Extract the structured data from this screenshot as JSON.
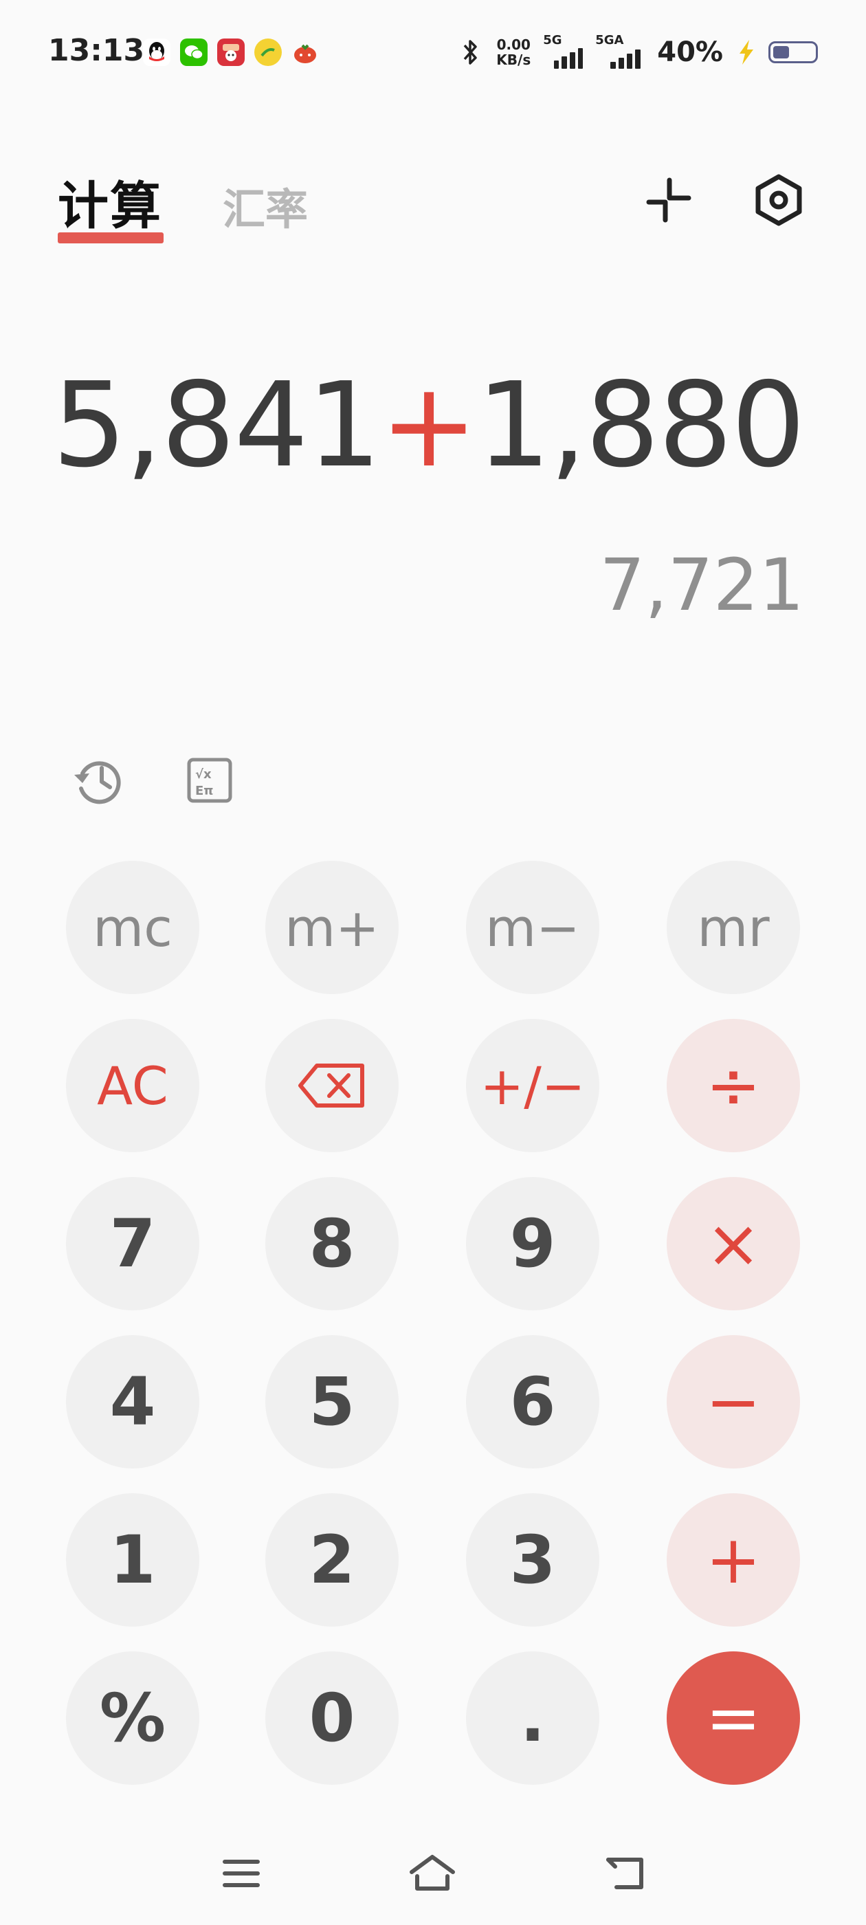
{
  "status_bar": {
    "time": "13:13",
    "net_speed_value": "0.00",
    "net_speed_unit": "KB/s",
    "signal1_label": "5G",
    "signal2_label": "5GA",
    "battery_percent": "40%",
    "battery_level": 0.4,
    "app_icons": [
      "qq-icon",
      "wechat-icon",
      "game-app-icon",
      "browser-app-icon",
      "tomato-app-icon"
    ]
  },
  "tabs": {
    "calculate": "计算",
    "exchange_rate": "汇率"
  },
  "display": {
    "operand_left": "5,841",
    "operator": "+",
    "operand_right": "1,880",
    "result": "7,721"
  },
  "keypad": {
    "mc": "mc",
    "mplus": "m+",
    "mminus": "m−",
    "mr": "mr",
    "ac": "AC",
    "sign": "+/−",
    "divide": "÷",
    "k7": "7",
    "k8": "8",
    "k9": "9",
    "multiply": "×",
    "k4": "4",
    "k5": "5",
    "k6": "6",
    "minus": "−",
    "k1": "1",
    "k2": "2",
    "k3": "3",
    "plus": "+",
    "percent": "%",
    "k0": "0",
    "dot": ".",
    "equals": "="
  },
  "colors": {
    "accent": "#e0473d",
    "equals_bg": "#df5a50",
    "operator_bg": "#f5e6e5",
    "key_bg": "#f0f0f0"
  }
}
